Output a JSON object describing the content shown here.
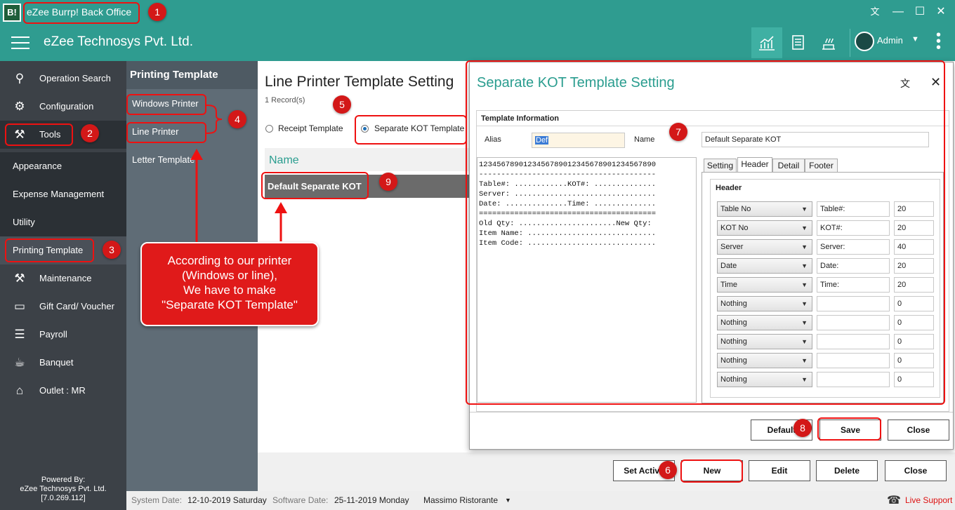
{
  "window": {
    "logo": "B!",
    "title": "eZee Burrp! Back Office"
  },
  "appbar": {
    "company": "eZee Technosys Pvt. Ltd.",
    "user": "Admin"
  },
  "sidebar": {
    "items": [
      {
        "label": "Operation Search",
        "icon": "search-icon"
      },
      {
        "label": "Configuration",
        "icon": "gear-icon"
      },
      {
        "label": "Tools",
        "icon": "tools-icon"
      },
      {
        "label": "Appearance"
      },
      {
        "label": "Expense Management"
      },
      {
        "label": "Utility"
      },
      {
        "label": "Printing Template"
      },
      {
        "label": "Maintenance",
        "icon": "worker-icon"
      },
      {
        "label": "Gift Card/ Voucher",
        "icon": "giftcard-icon"
      },
      {
        "label": "Payroll",
        "icon": "payroll-icon"
      },
      {
        "label": "Banquet",
        "icon": "banquet-icon"
      },
      {
        "label": "Outlet : MR",
        "icon": "outlet-icon"
      }
    ],
    "powered": [
      "Powered By:",
      "eZee Technosys Pvt. Ltd.",
      "[7.0.269.112]"
    ]
  },
  "submenu": {
    "title": "Printing Template",
    "items": [
      "Windows Printer",
      "Line Printer",
      "Letter Template"
    ]
  },
  "main": {
    "title": "Line Printer Template Setting",
    "records": "1 Record(s)",
    "radio_receipt": "Receipt Template",
    "radio_kot": "Separate KOT Template",
    "col_name": "Name",
    "row1": "Default Separate KOT"
  },
  "buttons": {
    "set_active": "Set Active",
    "new": "New",
    "edit": "Edit",
    "delete": "Delete",
    "close": "Close"
  },
  "status": {
    "system_date_label": "System Date:",
    "system_date": "12-10-2019 Saturday",
    "software_date_label": "Software Date:",
    "software_date": "25-11-2019 Monday",
    "outlet": "Massimo Ristorante",
    "live_support": "Live Support"
  },
  "dialog": {
    "title": "Separate KOT Template Setting",
    "group": "Template Information",
    "alias_label": "Alias",
    "alias_value": "Def",
    "name_label": "Name",
    "name_value": "Default Separate KOT",
    "preview": "1234567890123456789012345678901234567890\n----------------------------------------\nTable#: ............KOT#: ..............\nServer: ................................\nDate: ..............Time: ..............\n========================================\nOld Qty: ......................New Qty:\nItem Name: .............................\nItem Code: .............................",
    "tabs": [
      "Setting",
      "Header",
      "Detail",
      "Footer"
    ],
    "header_group": "Header",
    "rows": [
      {
        "field": "Table No",
        "caption": "Table#:",
        "width": "20"
      },
      {
        "field": "KOT No",
        "caption": "KOT#:",
        "width": "20"
      },
      {
        "field": "Server",
        "caption": "Server:",
        "width": "40"
      },
      {
        "field": "Date",
        "caption": "Date:",
        "width": "20"
      },
      {
        "field": "Time",
        "caption": "Time:",
        "width": "20"
      },
      {
        "field": "Nothing",
        "caption": "",
        "width": "0"
      },
      {
        "field": "Nothing",
        "caption": "",
        "width": "0"
      },
      {
        "field": "Nothing",
        "caption": "",
        "width": "0"
      },
      {
        "field": "Nothing",
        "caption": "",
        "width": "0"
      },
      {
        "field": "Nothing",
        "caption": "",
        "width": "0"
      }
    ],
    "btn_default": "Default",
    "btn_save": "Save",
    "btn_close": "Close"
  },
  "annotations": {
    "badges": [
      "1",
      "2",
      "3",
      "4",
      "5",
      "6",
      "7",
      "8",
      "9"
    ],
    "note": [
      "According to our printer",
      "(Windows or line),",
      "We have to make",
      "\"Separate KOT Template\""
    ]
  }
}
